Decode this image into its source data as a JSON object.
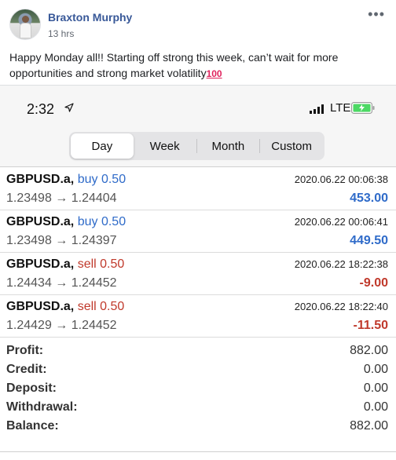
{
  "post": {
    "author": "Braxton Murphy",
    "time": "13 hrs",
    "more": "•••",
    "text": "Happy Monday all!! Starting off strong this week, can’t wait for more opportunities and strong market volatility",
    "emoji": "100"
  },
  "status": {
    "clock": "2:32",
    "network": "LTE"
  },
  "tabs": [
    "Day",
    "Week",
    "Month",
    "Custom"
  ],
  "active_tab": "Day",
  "trades": [
    {
      "symbol": "GBPUSD.a,",
      "side": "buy 0.50",
      "prices": "1.23498 → 1.24404",
      "time": "2020.06.22 00:06:38",
      "profit": "453.00"
    },
    {
      "symbol": "GBPUSD.a,",
      "side": "buy 0.50",
      "prices": "1.23498 → 1.24397",
      "time": "2020.06.22 00:06:41",
      "profit": "449.50"
    },
    {
      "symbol": "GBPUSD.a,",
      "side": "sell 0.50",
      "prices": "1.24434 → 1.24452",
      "time": "2020.06.22 18:22:38",
      "profit": "-9.00"
    },
    {
      "symbol": "GBPUSD.a,",
      "side": "sell 0.50",
      "prices": "1.24429 → 1.24452",
      "time": "2020.06.22 18:22:40",
      "profit": "-11.50"
    }
  ],
  "summary": [
    {
      "label": "Profit:",
      "value": "882.00"
    },
    {
      "label": "Credit:",
      "value": "0.00"
    },
    {
      "label": "Deposit:",
      "value": "0.00"
    },
    {
      "label": "Withdrawal:",
      "value": "0.00"
    },
    {
      "label": "Balance:",
      "value": "882.00"
    }
  ],
  "colors": {
    "buy": "#2f6bc9",
    "sell": "#c0392b",
    "author_link": "#385898"
  }
}
